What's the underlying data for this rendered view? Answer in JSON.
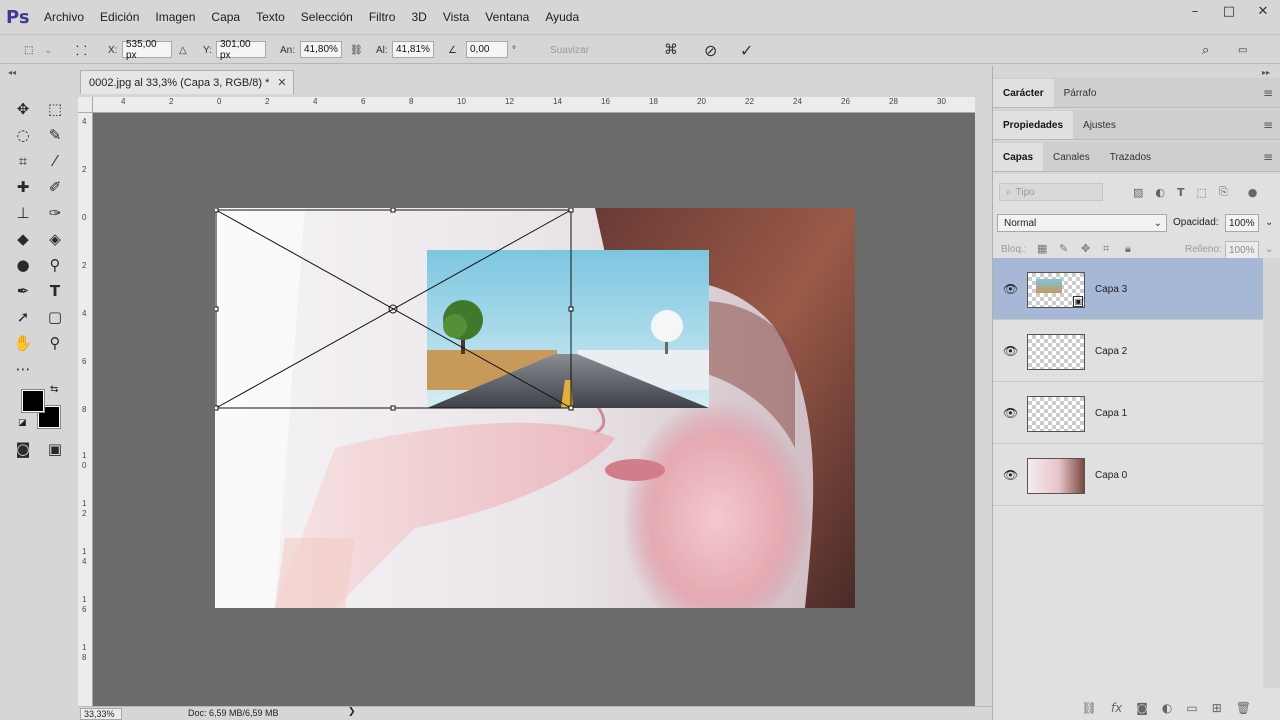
{
  "app": {
    "logo": "Ps",
    "menu": [
      "Archivo",
      "Edición",
      "Imagen",
      "Capa",
      "Texto",
      "Selección",
      "Filtro",
      "3D",
      "Vista",
      "Ventana",
      "Ayuda"
    ],
    "window_controls": {
      "minimize": "–",
      "maximize": "□",
      "close": "✕"
    }
  },
  "options": {
    "x_label": "X:",
    "x_value": "535,00 px",
    "y_label": "Y:",
    "y_value": "301,00 px",
    "w_label": "An:",
    "w_value": "41,80%",
    "h_label": "Al:",
    "h_value": "41,81%",
    "angle_value": "0,00",
    "angle_unit": "°",
    "smooth_label": "Suavizar",
    "cancel_icon": "⃠",
    "commit_icon": "✓"
  },
  "document": {
    "tab_title": "0002.jpg al 33,3% (Capa 3, RGB/8) *",
    "tab_close": "✕",
    "ruler_h": [
      "4",
      "2",
      "0",
      "2",
      "4",
      "6",
      "8",
      "10",
      "12",
      "14",
      "16",
      "18",
      "20",
      "22",
      "24",
      "26",
      "28",
      "30"
    ],
    "ruler_v": [
      "4",
      "2",
      "0",
      "2",
      "4",
      "6",
      "8",
      "1",
      "0",
      "1",
      "2",
      "1",
      "4",
      "1",
      "6",
      "1",
      "8"
    ],
    "zoom": "33,33%",
    "doc_size": "Doc: 6,59 MB/6,59 MB",
    "status_arrow": "❯"
  },
  "panels": {
    "group1": [
      "Carácter",
      "Párrafo"
    ],
    "group2": [
      "Propiedades",
      "Ajustes"
    ],
    "group3": [
      "Capas",
      "Canales",
      "Trazados"
    ],
    "filter_placeholder": "Tipo",
    "blend_mode": "Normal",
    "opacity_label": "Opacidad:",
    "opacity_value": "100%",
    "lock_label": "Bloq.:",
    "fill_label": "Relleno:",
    "fill_value": "100%",
    "layers": [
      {
        "name": "Capa 3",
        "selected": true
      },
      {
        "name": "Capa 2",
        "selected": false
      },
      {
        "name": "Capa 1",
        "selected": false
      },
      {
        "name": "Capa 0",
        "selected": false
      }
    ],
    "footer_icons": [
      "link-icon",
      "fx-icon",
      "mask-icon",
      "adjustment-icon",
      "group-icon",
      "new-layer-icon",
      "trash-icon"
    ]
  },
  "colors": {
    "foreground": "#000000",
    "background": "#000000",
    "selected_layer": "#a7b7d6",
    "pasteboard": "#6b6b6b"
  }
}
